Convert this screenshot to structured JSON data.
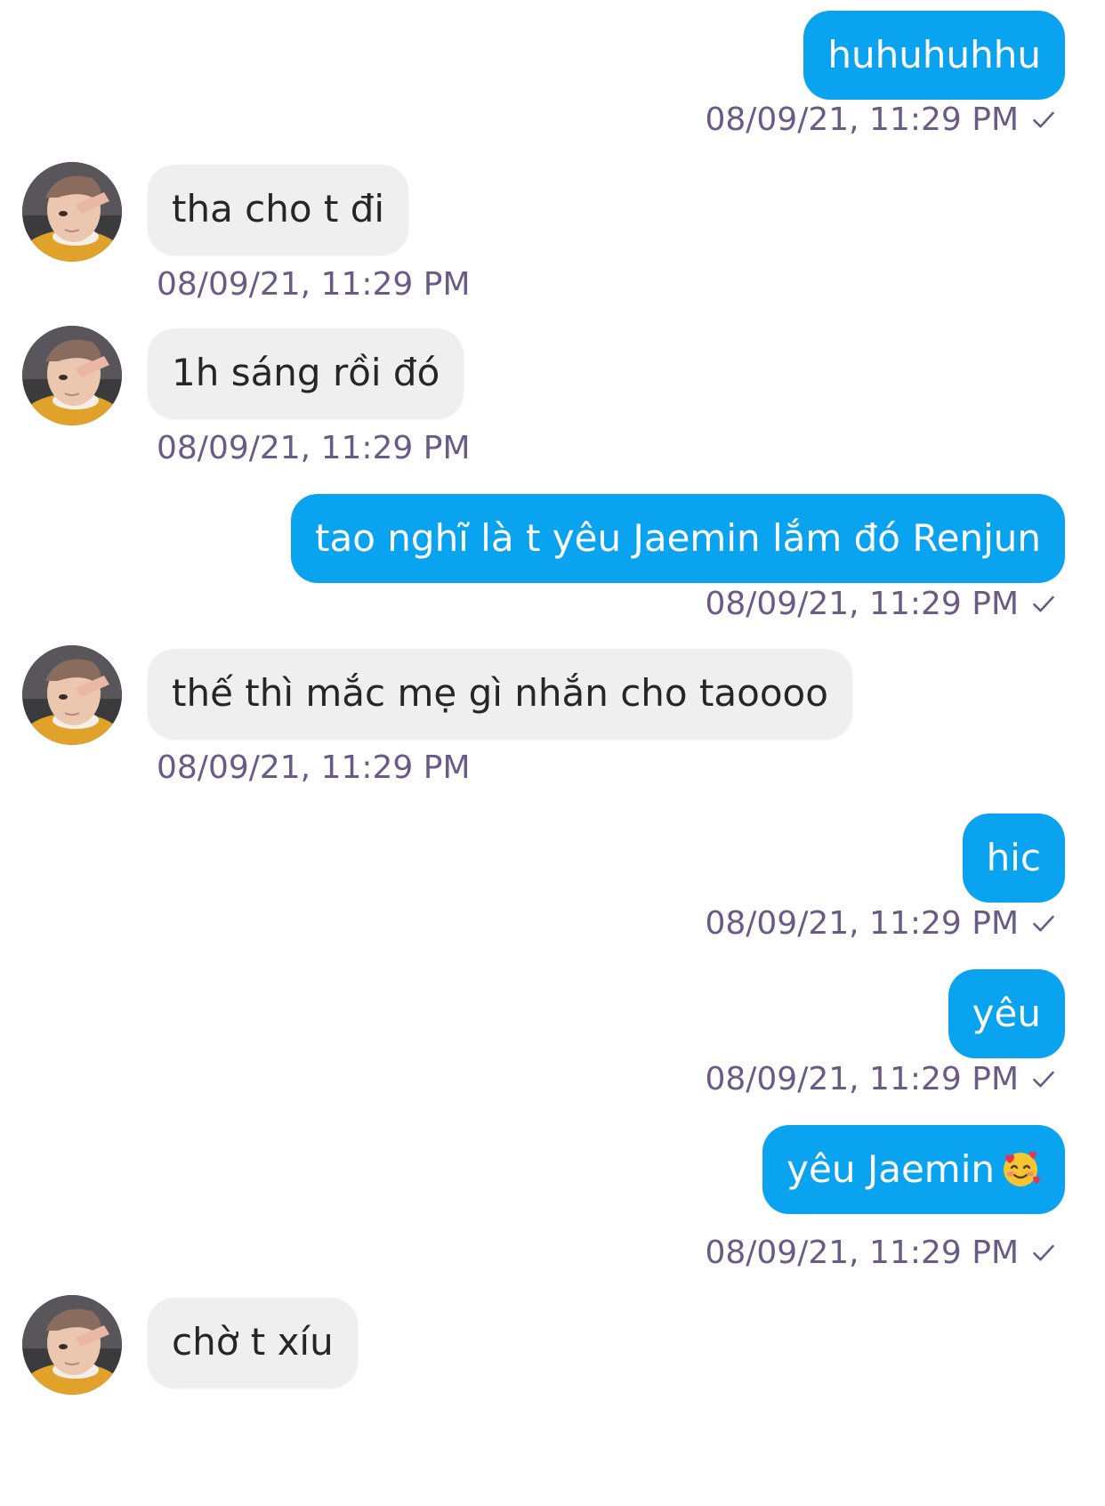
{
  "messages": [
    {
      "direction": "out",
      "text": "huhuhuhhu",
      "time": "08/09/21, 11:29 PM",
      "read": true
    },
    {
      "direction": "in",
      "text": "tha cho t đi",
      "time": "08/09/21, 11:29 PM"
    },
    {
      "direction": "in",
      "text": "1h sáng rồi đó",
      "time": "08/09/21, 11:29 PM"
    },
    {
      "direction": "out",
      "text": "tao nghĩ là t yêu Jaemin lắm đó Renjun",
      "time": "08/09/21, 11:29 PM",
      "read": true
    },
    {
      "direction": "in",
      "text": "thế thì mắc mẹ gì nhắn cho taoooo",
      "time": "08/09/21, 11:29 PM"
    },
    {
      "direction": "out",
      "text": "hic",
      "time": "08/09/21, 11:29 PM",
      "read": true
    },
    {
      "direction": "out",
      "text": "yêu",
      "time": "08/09/21, 11:29 PM",
      "read": true
    },
    {
      "direction": "out",
      "text": "yêu Jaemin",
      "emoji": "smiling-face-with-hearts",
      "time": "08/09/21, 11:29 PM",
      "read": true
    },
    {
      "direction": "in",
      "text": "chờ t xíu"
    }
  ],
  "colors": {
    "outgoing_bubble": "#0aa3ef",
    "incoming_bubble": "#efefef",
    "timestamp": "#6a5a87"
  },
  "icons": {
    "read_receipt": "check-icon",
    "avatar": "avatar-photo"
  }
}
